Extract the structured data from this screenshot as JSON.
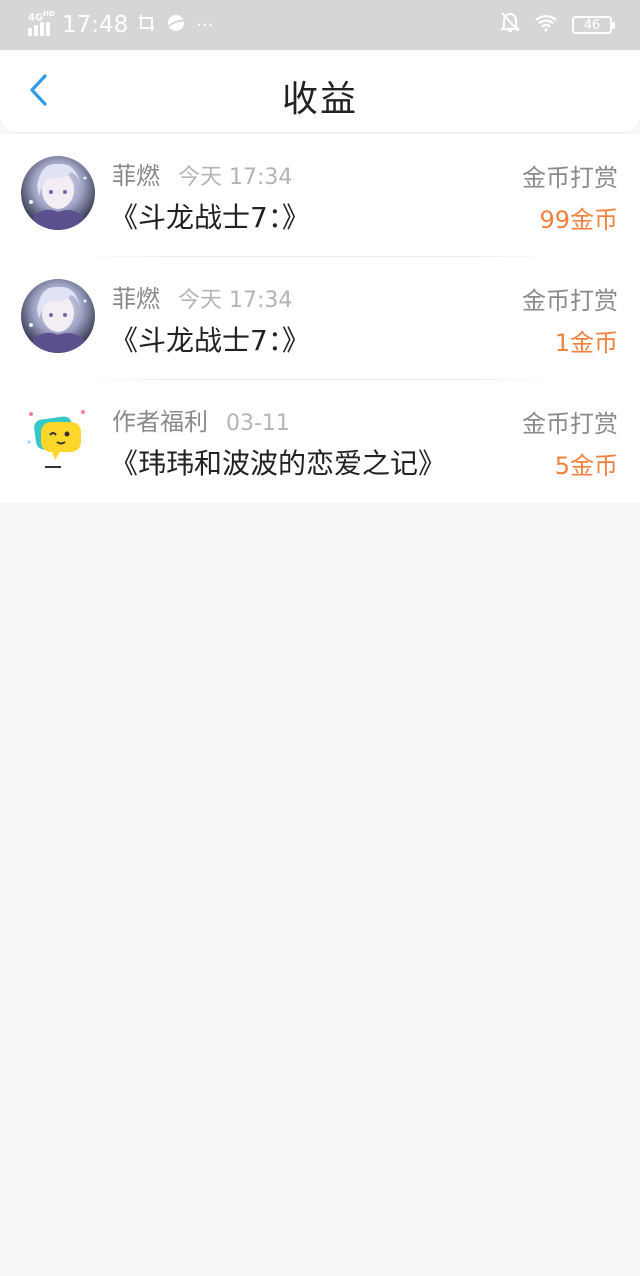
{
  "status_bar": {
    "network": "4G",
    "network_sup": "HD",
    "time": "17:48",
    "more": "···",
    "battery": "46"
  },
  "header": {
    "title": "收益"
  },
  "records": [
    {
      "name": "菲燃",
      "time": "今天 17:34",
      "title": "《斗龙战士7：》",
      "type": "金币打赏",
      "amount": "99金币",
      "avatar": "anime-girl-avatar"
    },
    {
      "name": "菲燃",
      "time": "今天 17:34",
      "title": "《斗龙战士7：》",
      "type": "金币打赏",
      "amount": "1金币",
      "avatar": "anime-girl-avatar"
    },
    {
      "name": "作者福利",
      "time": "03-11",
      "title": "《玮玮和波波的恋爱之记》",
      "type": "金币打赏",
      "amount": "5金币",
      "avatar": "yellow-chat-bubble-logo"
    }
  ],
  "colors": {
    "accent_blue": "#2f9ae6",
    "amount_orange": "#f08240",
    "status_bar_bg": "#d6d6d6",
    "page_bg": "#f9f7f8"
  }
}
